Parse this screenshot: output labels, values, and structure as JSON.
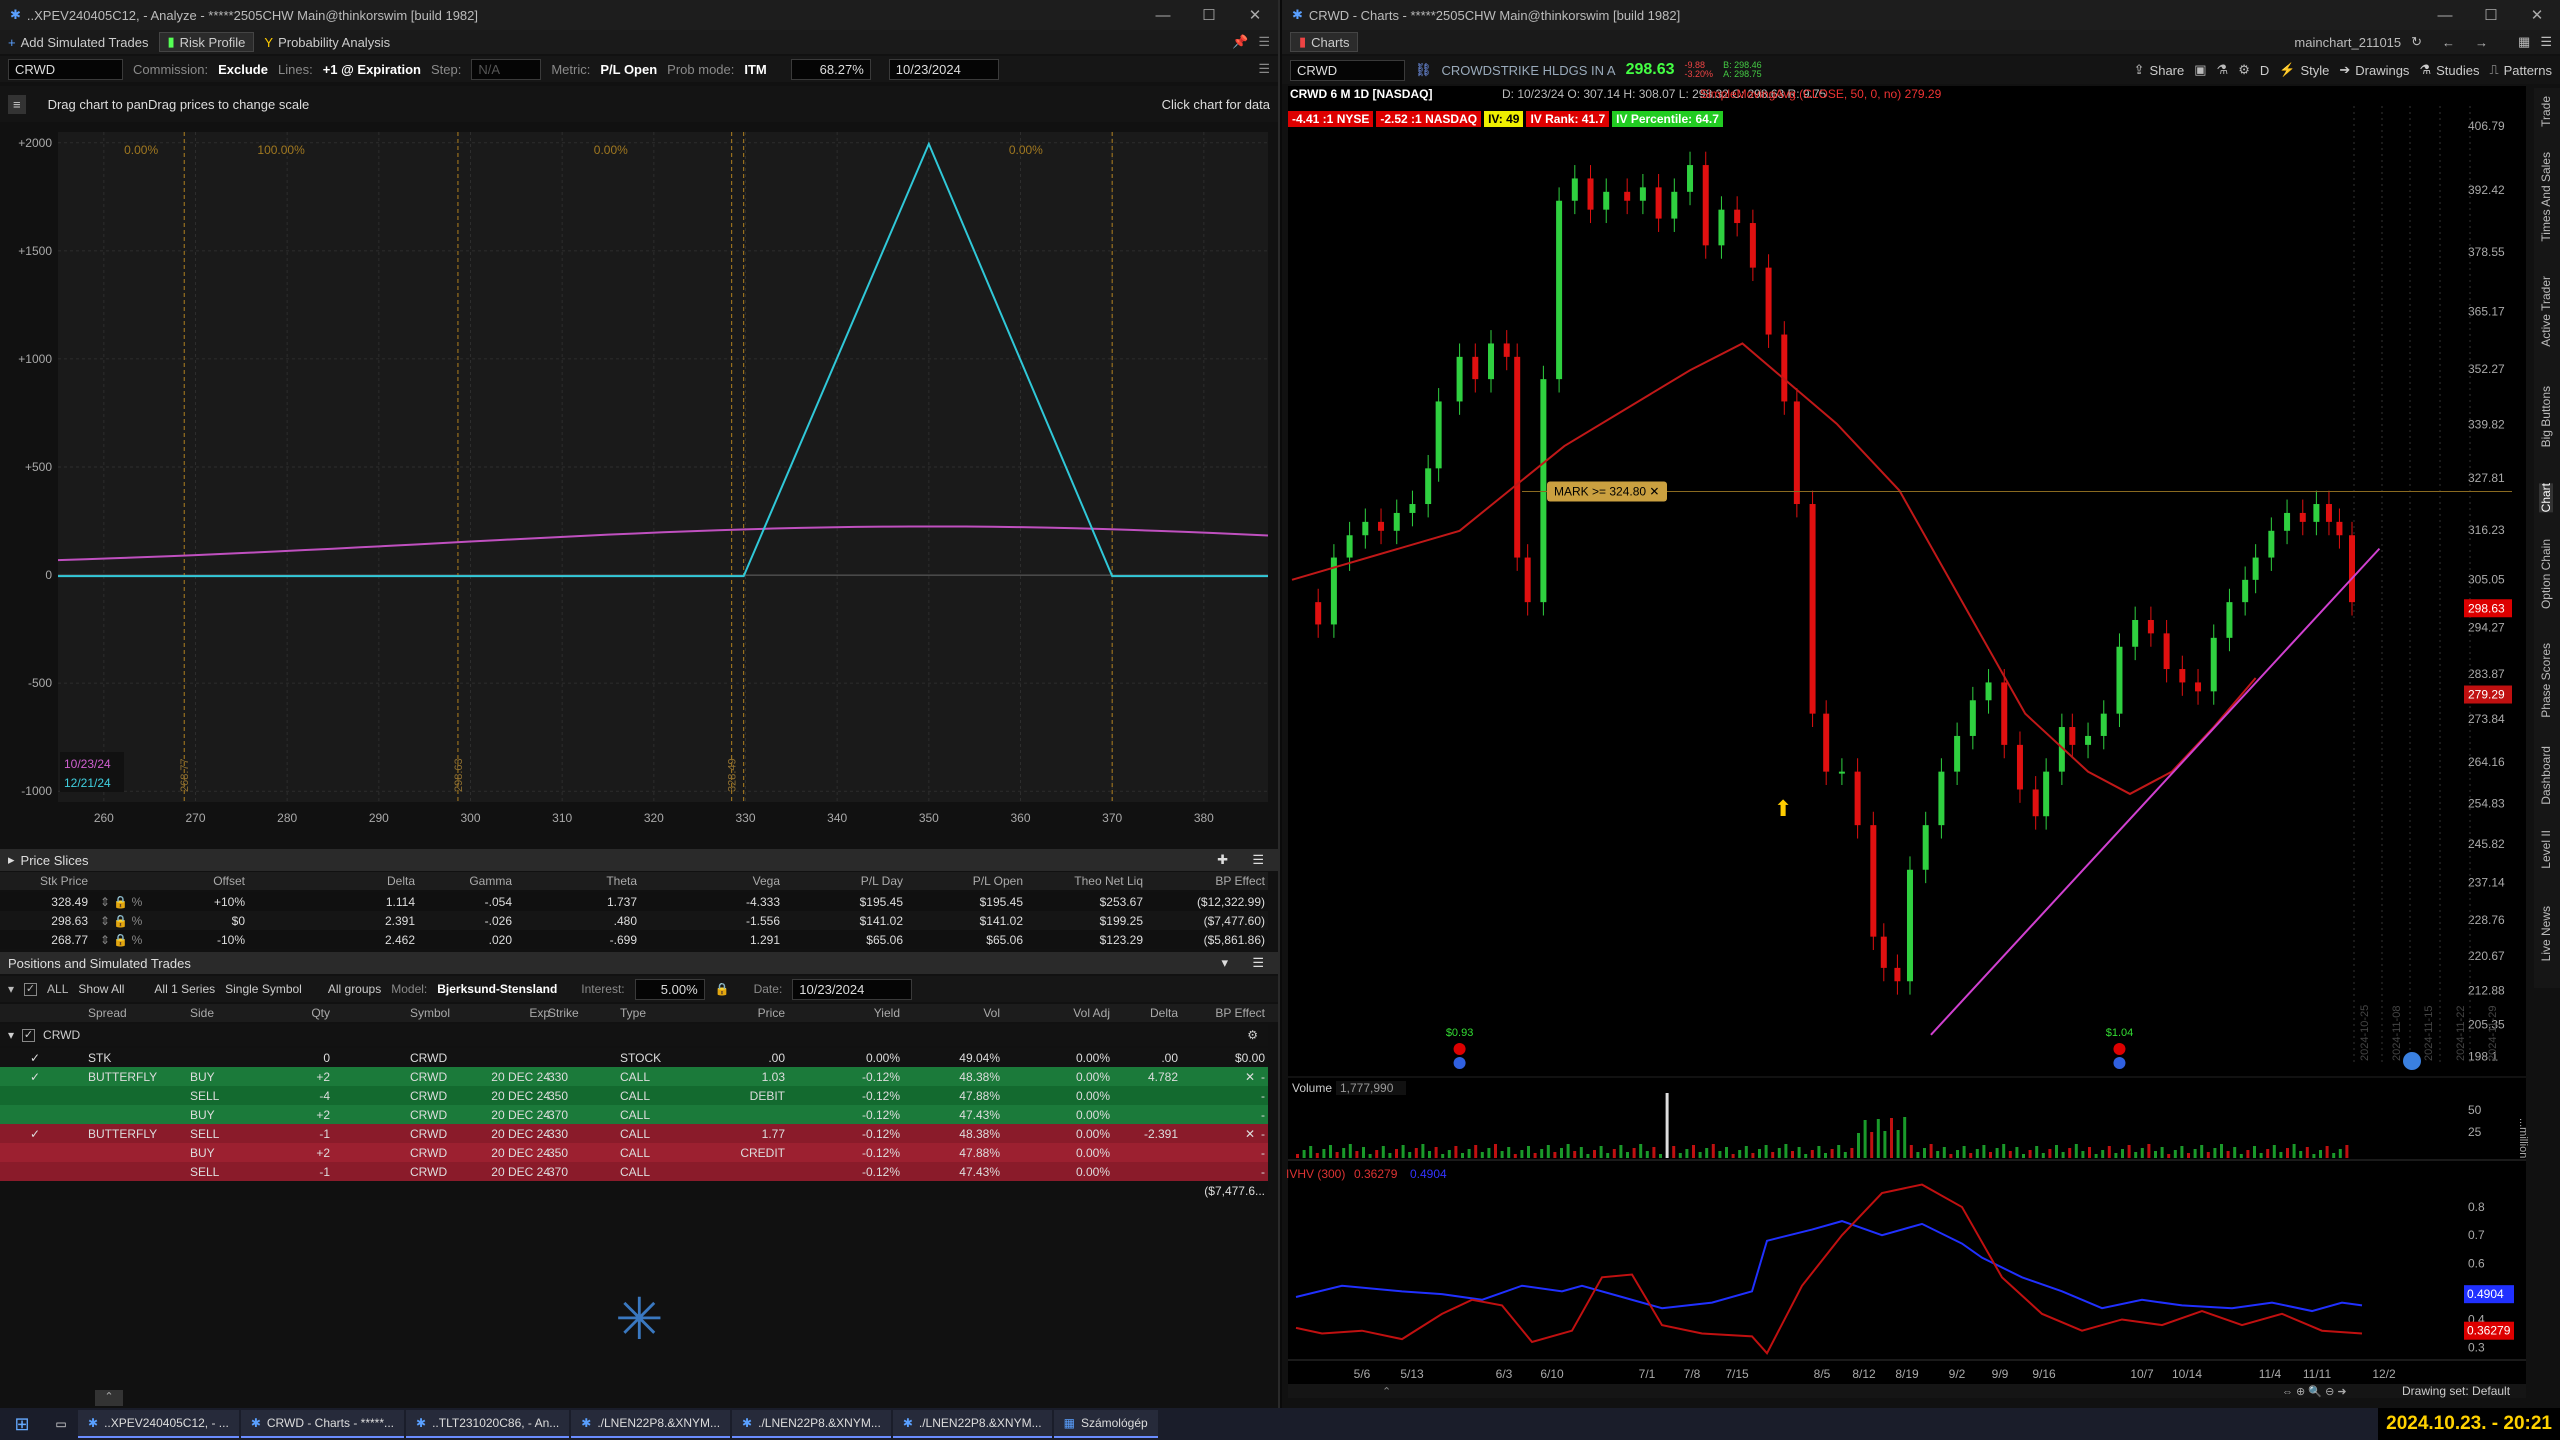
{
  "left": {
    "title": "..XPEV240405C12, - Analyze - *****2505CHW Main@thinkorswim [build 1982]",
    "tabs": [
      "Add Simulated Trades",
      "Risk Profile",
      "Probability Analysis"
    ],
    "symbol": "CRWD",
    "commission_label": "Commission:",
    "commission_value": "Exclude",
    "lines_label": "Lines:",
    "lines_value": "+1 @ Expiration",
    "step_label": "Step:",
    "step_value": "N/A",
    "metric_label": "Metric:",
    "metric_value": "P/L Open",
    "prob_label": "Prob mode:",
    "prob_value": "ITM",
    "iv_value": "68.27%",
    "date_value": "10/23/2024",
    "drag_hint": "Drag chart to panDrag prices to change scale",
    "click_hint": "Click chart for data",
    "y_ticks": [
      "+2000",
      "+1500",
      "+1000",
      "+500",
      "0",
      "-500",
      "-1000"
    ],
    "x_ticks": [
      "260",
      "270",
      "280",
      "290",
      "300",
      "310",
      "320",
      "330",
      "340",
      "350",
      "360",
      "370",
      "380"
    ],
    "prob_labels": [
      "0.00%",
      "100.00%",
      "0.00%",
      "0.00%"
    ],
    "vlabels": [
      "268.77",
      "298.63",
      "328.49"
    ],
    "legend": [
      "10/23/24",
      "12/21/24"
    ],
    "price_slices": {
      "title": "Price Slices",
      "headers": [
        "Stk Price",
        "Offset",
        "Delta",
        "Gamma",
        "Theta",
        "Vega",
        "P/L Day",
        "P/L Open",
        "Theo Net Liq",
        "BP Effect"
      ],
      "rows": [
        [
          "328.49",
          "+10%",
          "1.114",
          "-.054",
          "1.737",
          "-4.333",
          "$195.45",
          "$195.45",
          "$253.67",
          "($12,322.99)"
        ],
        [
          "298.63",
          "$0",
          "2.391",
          "-.026",
          ".480",
          "-1.556",
          "$141.02",
          "$141.02",
          "$199.25",
          "($7,477.60)"
        ],
        [
          "268.77",
          "-10%",
          "2.462",
          ".020",
          "-.699",
          "1.291",
          "$65.06",
          "$65.06",
          "$123.29",
          "($5,861.86)"
        ]
      ]
    },
    "positions": {
      "title": "Positions and Simulated Trades",
      "all_label": "ALL",
      "show": "Show All",
      "series": "All 1 Series",
      "single": "Single Symbol",
      "groups": "All groups",
      "model_label": "Model:",
      "model": "Bjerksund-Stensland",
      "interest_label": "Interest:",
      "interest": "5.00%",
      "date_label": "Date:",
      "date": "10/23/2024",
      "headers": [
        "Spread",
        "Side",
        "Qty",
        "Symbol",
        "Exp",
        "Strike",
        "Type",
        "Price",
        "Yield",
        "Vol",
        "Vol Adj",
        "Delta",
        "BP Effect"
      ],
      "group": "CRWD",
      "stk": {
        "spread": "STK",
        "qty": "0",
        "symbol": "CRWD",
        "type": "STOCK",
        "price": ".00",
        "yield": "0.00%",
        "vol": "49.04%",
        "voladj": "0.00%",
        "delta": ".00",
        "bp": "$0.00"
      },
      "rows": [
        {
          "spread": "BUTTERFLY",
          "side": "BUY",
          "qty": "+2",
          "symbol": "CRWD",
          "exp": "20 DEC 24",
          "strike": "330",
          "type": "CALL",
          "price": "1.03",
          "yield": "-0.12%",
          "vol": "48.38%",
          "voladj": "0.00%",
          "delta": "4.782",
          "bp": "-",
          "cls": "g"
        },
        {
          "spread": "",
          "side": "SELL",
          "qty": "-4",
          "symbol": "CRWD",
          "exp": "20 DEC 24",
          "strike": "350",
          "type": "CALL",
          "price": "DEBIT",
          "yield": "-0.12%",
          "vol": "47.88%",
          "voladj": "0.00%",
          "delta": "",
          "bp": "-",
          "cls": "g"
        },
        {
          "spread": "",
          "side": "BUY",
          "qty": "+2",
          "symbol": "CRWD",
          "exp": "20 DEC 24",
          "strike": "370",
          "type": "CALL",
          "price": "",
          "yield": "-0.12%",
          "vol": "47.43%",
          "voladj": "0.00%",
          "delta": "",
          "bp": "-",
          "cls": "g"
        },
        {
          "spread": "BUTTERFLY",
          "side": "SELL",
          "qty": "-1",
          "symbol": "CRWD",
          "exp": "20 DEC 24",
          "strike": "330",
          "type": "CALL",
          "price": "1.77",
          "yield": "-0.12%",
          "vol": "48.38%",
          "voladj": "0.00%",
          "delta": "-2.391",
          "bp": "-",
          "cls": "rd"
        },
        {
          "spread": "",
          "side": "BUY",
          "qty": "+2",
          "symbol": "CRWD",
          "exp": "20 DEC 24",
          "strike": "350",
          "type": "CALL",
          "price": "CREDIT",
          "yield": "-0.12%",
          "vol": "47.88%",
          "voladj": "0.00%",
          "delta": "",
          "bp": "-",
          "cls": "rd"
        },
        {
          "spread": "",
          "side": "SELL",
          "qty": "-1",
          "symbol": "CRWD",
          "exp": "20 DEC 24",
          "strike": "370",
          "type": "CALL",
          "price": "",
          "yield": "-0.12%",
          "vol": "47.43%",
          "voladj": "0.00%",
          "delta": "",
          "bp": "-",
          "cls": "rd"
        }
      ],
      "total_bp": "($7,477.6..."
    }
  },
  "right": {
    "title": "CRWD - Charts - *****2505CHW Main@thinkorswim [build 1982]",
    "tab": "Charts",
    "chart_name": "mainchart_211015",
    "symbol": "CRWD",
    "company": "CROWDSTRIKE HLDGS IN A",
    "last": "298.63",
    "chg": "-9.88",
    "chgpct": "-3.20%",
    "bid": "B: 298.46",
    "ask": "A: 298.75",
    "toolbar": [
      "Share",
      "D",
      "Style",
      "Drawings",
      "Studies",
      "Patterns"
    ],
    "chart_label": "CRWD 6 M 1D [NASDAQ]",
    "ohlc": "D: 10/23/24   O: 307.14   H: 308.07   L: 298.32   C: 298.63   R: 9.75",
    "sma_label": "SimpleMovingAvg (CLOSE, 50, 0, no)",
    "sma_val": "279.29",
    "badges": [
      "-4.41 :1 NYSE",
      "-2.52 :1 NASDAQ",
      "IV: 49",
      "IV Rank: 41.7",
      "IV Percentile: 64.7"
    ],
    "mark": "MARK >= 324.80",
    "price_ticks": [
      "406.79",
      "392.42",
      "378.55",
      "365.17",
      "352.27",
      "339.82",
      "327.81",
      "316.23",
      "305.05",
      "294.27",
      "283.87",
      "273.84",
      "264.16",
      "254.83",
      "245.82",
      "237.14",
      "228.76",
      "220.67",
      "212.88",
      "205.35",
      "198.1"
    ],
    "last_tag": "298.63",
    "sma_tag": "279.29",
    "date_ticks": [
      "5/6",
      "5/13",
      "6/3",
      "6/10",
      "7/1",
      "7/8",
      "7/15",
      "8/5",
      "8/12",
      "8/19",
      "9/2",
      "9/9",
      "9/16",
      "10/7",
      "10/14",
      "11/4",
      "11/11",
      "12/2"
    ],
    "future_dates": [
      "2024-10-25",
      "2024-11-08",
      "2024-11-15",
      "2024-11-22",
      "2024-11-29"
    ],
    "div": [
      "$0.93",
      "$1.04"
    ],
    "volume_label": "Volume",
    "volume": "1,777,990",
    "vol_ticks": [
      "50",
      "25"
    ],
    "vol_unit": "...million",
    "ivhv_label": "IVHV (300)",
    "ivhv_v1": "0.36279",
    "ivhv_v2": "0.4904",
    "ivhv_ticks": [
      "0.8",
      "0.7",
      "0.6",
      "0.5",
      "0.4",
      "0.3"
    ],
    "ivhv_tags": [
      "0.4904",
      "0.36279"
    ],
    "drawing_set": "Drawing set: Default",
    "side_tabs": [
      "Trade",
      "Times And Sales",
      "Active Trader",
      "Big Buttons",
      "Chart",
      "Option Chain",
      "Phase Scores",
      "Dashboard",
      "Level II",
      "Live News"
    ]
  },
  "taskbar": {
    "items": [
      "..XPEV240405C12, - ...",
      "CRWD - Charts - *****...",
      "..TLT231020C86, - An...",
      "./LNEN22P8.&XNYM...",
      "./LNEN22P8.&XNYM...",
      "./LNEN22P8.&XNYM...",
      "Számológép"
    ],
    "clock": "2024.10.23. - 20:21"
  }
}
